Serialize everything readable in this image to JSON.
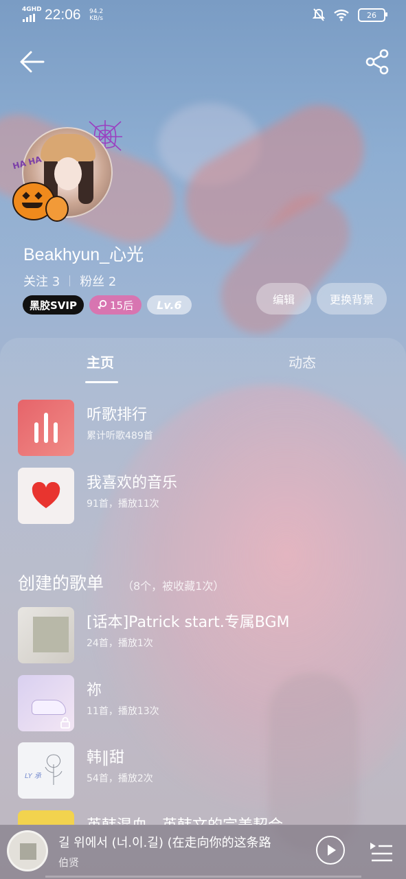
{
  "status_bar": {
    "network": "4GHD",
    "time": "22:06",
    "speed_value": "94.2",
    "speed_unit": "KB/s",
    "battery": "26"
  },
  "profile": {
    "username": "Beakhyun_心光",
    "following_label": "关注 3",
    "fans_label": "粉丝 2",
    "vip_badge": "黑胶SVIP",
    "age_badge": "15后",
    "level_badge": "Lv.6",
    "edit_label": "编辑",
    "change_bg_label": "更换背景",
    "avatar_deco_text": "HA HA"
  },
  "tabs": [
    {
      "label": "主页"
    },
    {
      "label": "动态"
    }
  ],
  "fixed_items": [
    {
      "title": "听歌排行",
      "subtitle": "累计听歌489首",
      "icon": "bar-chart-icon"
    },
    {
      "title": "我喜欢的音乐",
      "subtitle": "91首，播放11次",
      "icon": "heart-icon"
    }
  ],
  "created_playlists": {
    "title": "创建的歌单",
    "meta": "（8个，被收藏1次）",
    "items": [
      {
        "title": "[话本]Patrick start.专属BGM",
        "subtitle": "24首，播放1次"
      },
      {
        "title": "祢",
        "subtitle": "11首，播放13次"
      },
      {
        "title": "韩‖甜",
        "subtitle": "54首，播放2次"
      },
      {
        "title": "英韩混血．英韩文的完美契合",
        "subtitle": ""
      }
    ]
  },
  "player": {
    "title": "길 위에서 (너.이.길) (在走向你的这条路",
    "artist": "伯贤"
  },
  "colors": {
    "accent_red": "#e6646a",
    "heart_red": "#e8342f",
    "age_badge": "#e26aaa"
  }
}
